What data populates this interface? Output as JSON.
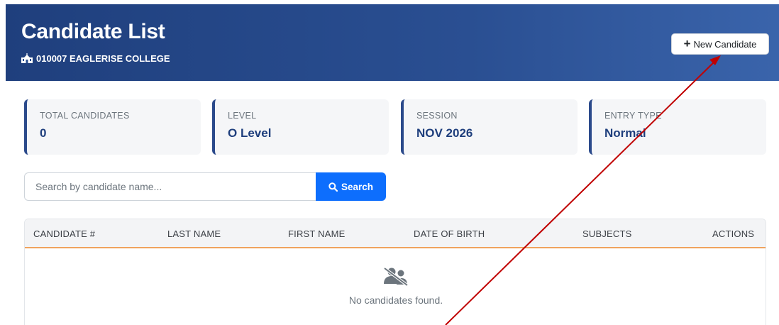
{
  "header": {
    "title": "Candidate List",
    "school": "010007 EAGLERISE COLLEGE",
    "school_icon": "school-building-icon",
    "new_button_label": "New Candidate",
    "new_button_icon": "plus-icon"
  },
  "stats": [
    {
      "label": "TOTAL CANDIDATES",
      "value": "0"
    },
    {
      "label": "LEVEL",
      "value": "O Level"
    },
    {
      "label": "SESSION",
      "value": "NOV 2026"
    },
    {
      "label": "ENTRY TYPE",
      "value": "Normal"
    }
  ],
  "search": {
    "placeholder": "Search by candidate name...",
    "value": "",
    "button_label": "Search",
    "button_icon": "search-icon"
  },
  "table": {
    "columns": [
      "CANDIDATE #",
      "LAST NAME",
      "FIRST NAME",
      "DATE OF BIRTH",
      "SUBJECTS",
      "ACTIONS"
    ],
    "rows": [],
    "empty_message": "No candidates found.",
    "empty_icon": "users-slash-icon"
  },
  "colors": {
    "header_start": "#1f3f7d",
    "header_end": "#3a64ab",
    "accent_blue": "#0d6efd",
    "card_accent": "#2b4a8b",
    "table_header_border": "#f0a35e",
    "annotation_arrow": "#c00000"
  }
}
